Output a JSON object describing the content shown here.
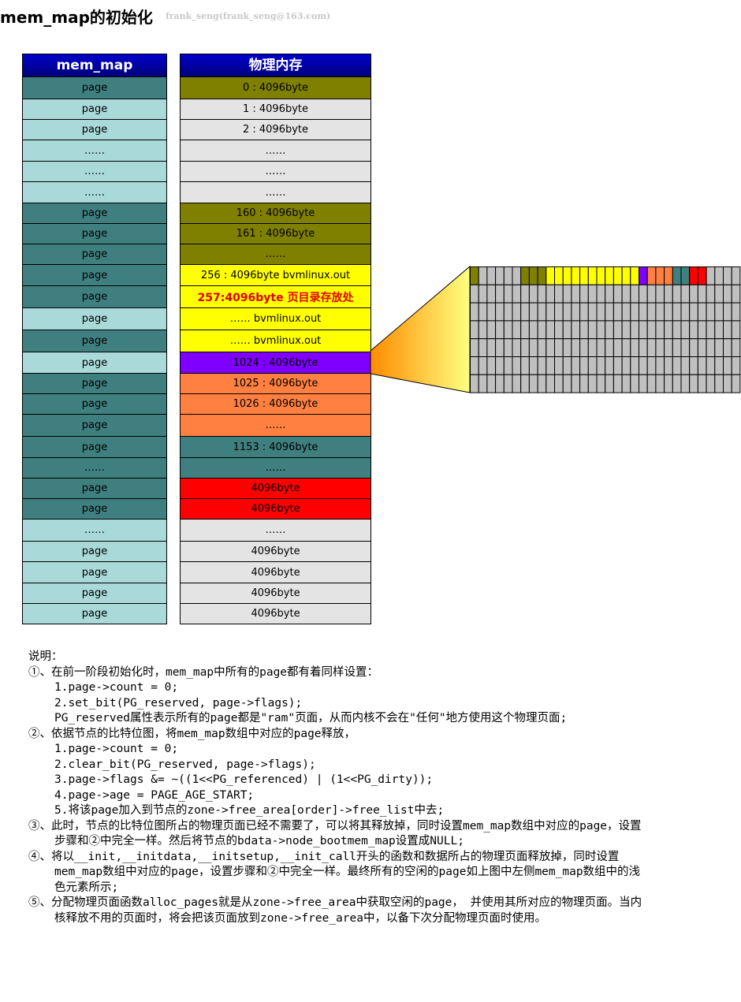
{
  "title": "mem_map的初始化",
  "author": "frank_seng(frank_seng@163.com)",
  "left_column": {
    "header": "mem_map",
    "rows": [
      {
        "text": "page",
        "color": "#3f7f7f"
      },
      {
        "text": "page",
        "color": "#a9d9d9"
      },
      {
        "text": "page",
        "color": "#a9d9d9"
      },
      {
        "text": "……",
        "color": "#a9d9d9"
      },
      {
        "text": "……",
        "color": "#a9d9d9"
      },
      {
        "text": "……",
        "color": "#a9d9d9"
      },
      {
        "text": "page",
        "color": "#3f7f7f"
      },
      {
        "text": "page",
        "color": "#3f7f7f"
      },
      {
        "text": "page",
        "color": "#3f7f7f"
      },
      {
        "text": "page",
        "color": "#3f7f7f"
      },
      {
        "text": "page",
        "color": "#3f7f7f"
      },
      {
        "text": "page",
        "color": "#a9d9d9"
      },
      {
        "text": "page",
        "color": "#3f7f7f"
      },
      {
        "text": "page",
        "color": "#a9d9d9"
      },
      {
        "text": "page",
        "color": "#3f7f7f"
      },
      {
        "text": "page",
        "color": "#3f7f7f"
      },
      {
        "text": "page",
        "color": "#3f7f7f"
      },
      {
        "text": "page",
        "color": "#3f7f7f"
      },
      {
        "text": "……",
        "color": "#3f7f7f"
      },
      {
        "text": "page",
        "color": "#3f7f7f"
      },
      {
        "text": "page",
        "color": "#3f7f7f"
      },
      {
        "text": "……",
        "color": "#a9d9d9"
      },
      {
        "text": "page",
        "color": "#a9d9d9"
      },
      {
        "text": "page",
        "color": "#a9d9d9"
      },
      {
        "text": "page",
        "color": "#a9d9d9"
      },
      {
        "text": "page",
        "color": "#a9d9d9"
      }
    ]
  },
  "right_column": {
    "header": "物理内存",
    "rows": [
      {
        "text": "0 : 4096byte",
        "color": "#808000",
        "text_color": "#000000"
      },
      {
        "text": "1 : 4096byte",
        "color": "#e4e4e4",
        "text_color": "#000000"
      },
      {
        "text": "2 : 4096byte",
        "color": "#e4e4e4",
        "text_color": "#000000"
      },
      {
        "text": "……",
        "color": "#e4e4e4",
        "text_color": "#000000"
      },
      {
        "text": "……",
        "color": "#e4e4e4",
        "text_color": "#000000"
      },
      {
        "text": "……",
        "color": "#e4e4e4",
        "text_color": "#000000"
      },
      {
        "text": "160 : 4096byte",
        "color": "#808000",
        "text_color": "#000000"
      },
      {
        "text": "161 : 4096byte",
        "color": "#808000",
        "text_color": "#000000"
      },
      {
        "text": "……",
        "color": "#808000",
        "text_color": "#000000"
      },
      {
        "text": "256 : 4096byte bvmlinux.out",
        "color": "#ffff00",
        "text_color": "#000000"
      },
      {
        "text": "257:4096byte 页目录存放处",
        "color": "#ffff00",
        "text_color": "#e00000",
        "bold": true
      },
      {
        "text": "…… bvmlinux.out",
        "color": "#ffff00",
        "text_color": "#000000"
      },
      {
        "text": "…… bvmlinux.out",
        "color": "#ffff00",
        "text_color": "#000000"
      },
      {
        "text": "1024 : 4096byte",
        "color": "#7f00ff",
        "text_color": "#000000"
      },
      {
        "text": "1025 : 4096byte",
        "color": "#ff8040",
        "text_color": "#000000"
      },
      {
        "text": "1026 : 4096byte",
        "color": "#ff8040",
        "text_color": "#000000"
      },
      {
        "text": "……",
        "color": "#ff8040",
        "text_color": "#000000"
      },
      {
        "text": "1153 : 4096byte",
        "color": "#3f7f7f",
        "text_color": "#000000"
      },
      {
        "text": "……",
        "color": "#3f7f7f",
        "text_color": "#000000"
      },
      {
        "text": "4096byte",
        "color": "#ff0000",
        "text_color": "#000000"
      },
      {
        "text": "4096byte",
        "color": "#ff0000",
        "text_color": "#000000"
      },
      {
        "text": "……",
        "color": "#e4e4e4",
        "text_color": "#000000"
      },
      {
        "text": "4096byte",
        "color": "#e4e4e4",
        "text_color": "#000000"
      },
      {
        "text": "4096byte",
        "color": "#e4e4e4",
        "text_color": "#000000"
      },
      {
        "text": "4096byte",
        "color": "#e4e4e4",
        "text_color": "#000000"
      },
      {
        "text": "4096byte",
        "color": "#e4e4e4",
        "text_color": "#000000"
      }
    ]
  },
  "bitmap": {
    "columns": 32,
    "rows": 7,
    "default_color": "#c0c0c0",
    "zoom_gradient": [
      "#ff8c00",
      "#ffff80"
    ],
    "first_row": [
      "#808000",
      "#c0c0c0",
      "#c0c0c0",
      "#c0c0c0",
      "#c0c0c0",
      "#c0c0c0",
      "#808000",
      "#808000",
      "#808000",
      "#ffff00",
      "#ffff00",
      "#ffff00",
      "#ffff00",
      "#ffff00",
      "#ffff00",
      "#ffff00",
      "#ffff00",
      "#ffff00",
      "#ffff00",
      "#ffff00",
      "#7f00ff",
      "#ff8040",
      "#ff8040",
      "#ff8040",
      "#3f7f7f",
      "#3f7f7f",
      "#ff0000",
      "#ff0000",
      "#c0c0c0",
      "#c0c0c0",
      "#c0c0c0",
      "#c0c0c0"
    ]
  },
  "notes": {
    "heading": "说明：",
    "s1": "①、在前一阶段初始化时，mem_map中所有的page都有着同样设置：",
    "s1_1": "1.page->count = 0;",
    "s1_2": "2.set_bit(PG_reserved, page->flags);",
    "s1_3": "PG_reserved属性表示所有的page都是\"ram\"页面，从而内核不会在\"任何\"地方使用这个物理页面;",
    "s2": "②、依据节点的比特位图，将mem_map数组中对应的page释放，",
    "s2_1": "1.page->count = 0;",
    "s2_2": "2.clear_bit(PG_reserved, page->flags);",
    "s2_3": "3.page->flags &= ~((1<<PG_referenced) | (1<<PG_dirty));",
    "s2_4": "4.page->age = PAGE_AGE_START;",
    "s2_5": "5.将该page加入到节点的zone->free_area[order]->free_list中去;",
    "s3": "③、此时，节点的比特位图所占的物理页面已经不需要了，可以将其释放掉，同时设置mem_map数组中对应的page，设置步骤和②中完全一样。然后将节点的bdata->node_bootmem_map设置成NULL;",
    "s4": "④、将以__init,__initdata,__initsetup,__init_call开头的函数和数据所占的物理页面释放掉，同时设置mem_map数组中对应的page，设置步骤和②中完全一样。最终所有的空闲的page如上图中左侧mem_map数组中的浅色元素所示;",
    "s5": "⑤、分配物理页面函数alloc_pages就是从zone->free_area中获取空闲的page， 并使用其所对应的物理页面。当内核释放不用的页面时，将会把该页面放到zone->free_area中，以备下次分配物理页面时使用。"
  }
}
